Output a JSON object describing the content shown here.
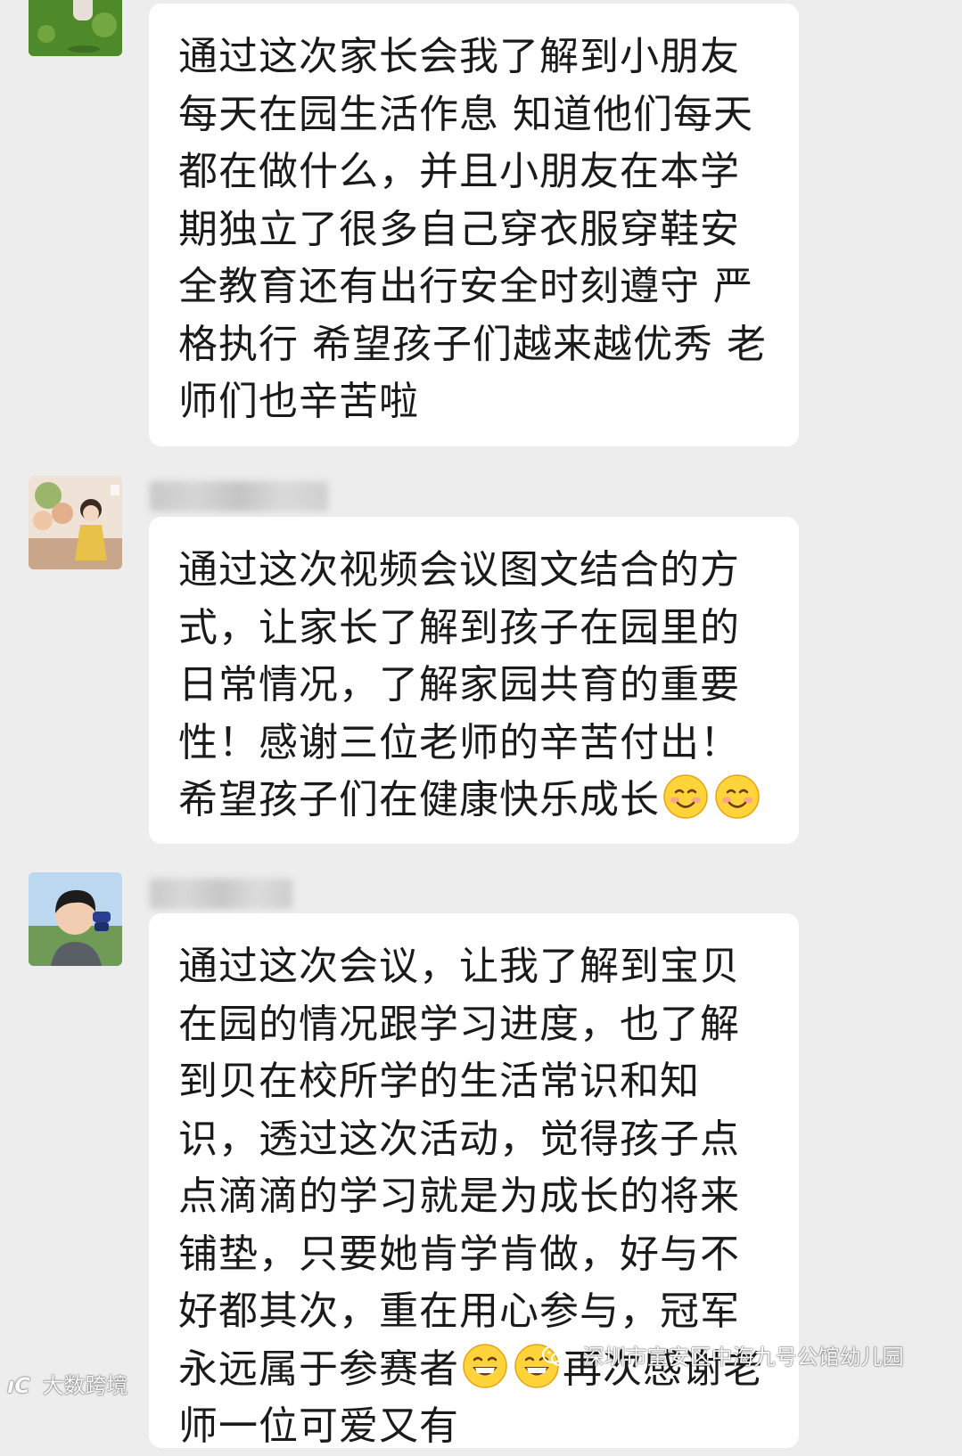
{
  "messages": [
    {
      "avatar_icon": "avatar-child-on-grass-icon",
      "text": "通过这次家长会我了解到小朋友每天在园生活作息 知道他们每天都在做什么，并且小朋友在本学期独立了很多自己穿衣服穿鞋安全教育还有出行安全时刻遵守 严格执行 希望孩子们越来越优秀 老师们也辛苦啦",
      "emojis": []
    },
    {
      "avatar_icon": "avatar-girl-with-balloons-icon",
      "text": "通过这次视频会议图文结合的方式，让家长了解到孩子在园里的日常情况，了解家园共育的重要性！感谢三位老师的辛苦付出！希望孩子们在健康快乐成长",
      "emojis": [
        "smiling-face-emoji",
        "smiling-face-emoji"
      ]
    },
    {
      "avatar_icon": "avatar-boy-with-binoculars-icon",
      "text_part1": "通过这次会议，让我了解到宝贝在园的情况跟学习进度，也了解到贝在校所学的生活常识和知识，透过这次活动，觉得孩子点点滴滴的学习就是为成长的将来铺垫，只要她肯学肯做，好与不好都其次，重在用心参与，冠军永远属于参赛者",
      "text_part2": "再次感谢老师一位可爱又有",
      "emojis": [
        "grinning-face-emoji",
        "grinning-face-emoji"
      ]
    }
  ],
  "watermarks": {
    "left": "大数跨境",
    "left_icon": "bilibili-logo-icon",
    "right": "深圳市宝安区中海九号公馆幼儿园",
    "right_icon": "wechat-logo-icon"
  },
  "colors": {
    "background": "#ededed",
    "bubble": "#ffffff",
    "text": "#1a1a1a"
  }
}
